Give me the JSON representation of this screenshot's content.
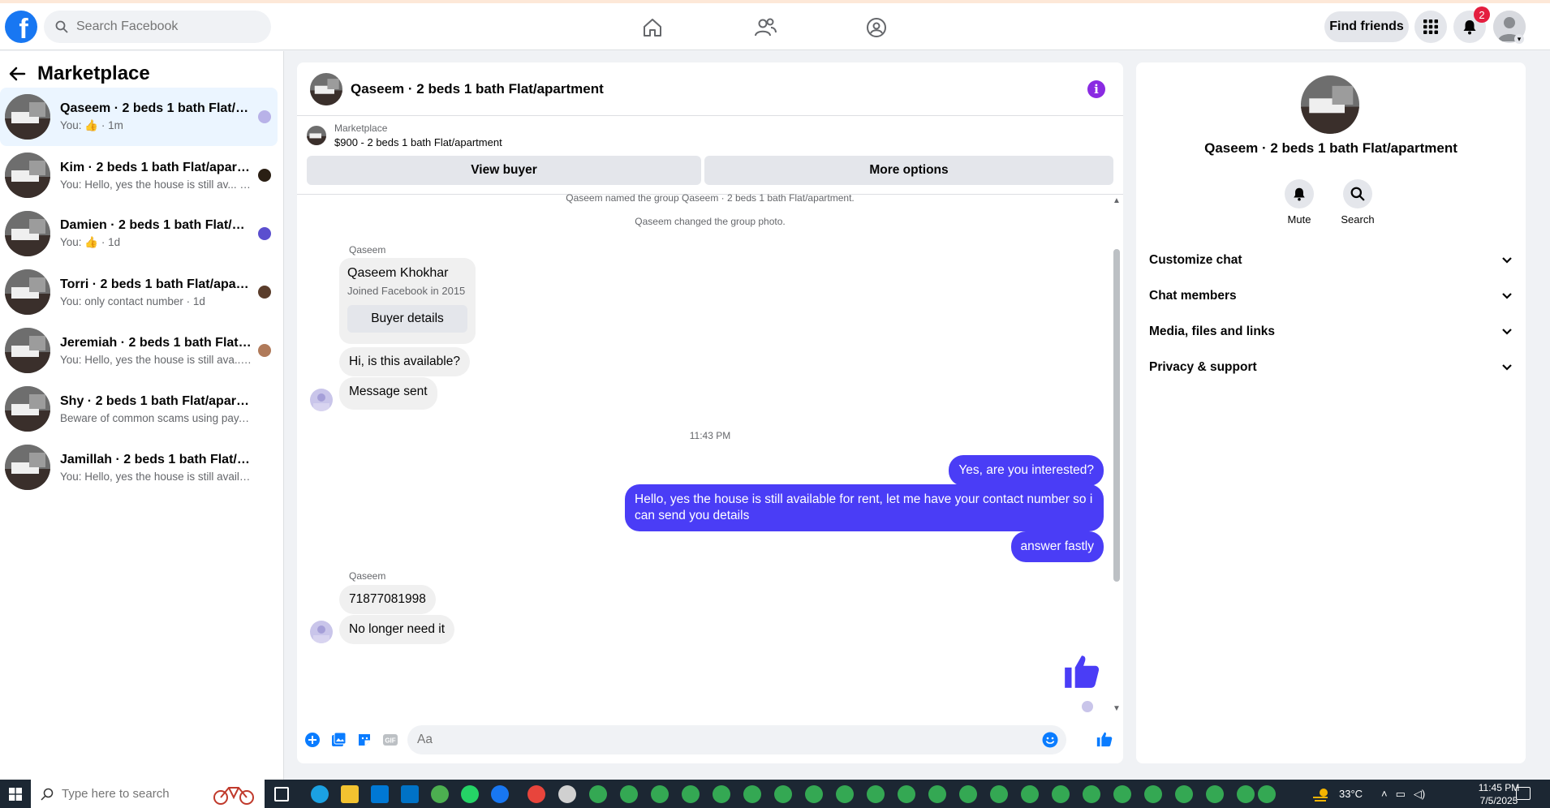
{
  "topbar": {
    "logo_letter": "f",
    "search_placeholder": "Search Facebook",
    "find_friends": "Find friends",
    "notification_count": "2"
  },
  "sidebar": {
    "title": "Marketplace",
    "conversations": [
      {
        "name": "Qaseem · 2 beds 1 bath Flat/apa...",
        "preview": "You: 👍 · 1m",
        "active": true
      },
      {
        "name": "Kim · 2 beds 1 bath Flat/apartm...",
        "preview": "You: Hello, yes the house is still av... · 1m"
      },
      {
        "name": "Damien · 2 beds 1 bath Flat/apa...",
        "preview": "You: 👍 · 1d"
      },
      {
        "name": "Torri · 2 beds 1 bath Flat/apartm...",
        "preview": "You: only contact number · 1d"
      },
      {
        "name": "Jeremiah · 2 beds 1 bath Flat/ap...",
        "preview": "You: Hello, yes the house is still ava... · 1d"
      },
      {
        "name": "Shy · 2 beds 1 bath Flat/apartment",
        "preview": "Beware of common scams using pay... · 2d"
      },
      {
        "name": "Jamillah · 2 beds 1 bath Flat/apart...",
        "preview": "You: Hello, yes the house is still availa... · 2d"
      }
    ]
  },
  "chat": {
    "title": "Qaseem · 2 beds 1 bath Flat/apartment",
    "marketplace_label": "Marketplace",
    "listing": "$900 - 2 beds 1 bath Flat/apartment",
    "view_buyer": "View buyer",
    "more_options": "More options",
    "system_1": "Qaseem named the group Qaseem · 2 beds 1 bath Flat/apartment.",
    "system_2": "Qaseem changed the group photo.",
    "sender_1": "Qaseem",
    "card_name": "Qaseem Khokhar",
    "card_sub": "Joined Facebook in 2015",
    "card_button": "Buyer details",
    "msg_in_1": "Hi, is this available?",
    "msg_in_2": "Message sent",
    "timestamp": "11:43 PM",
    "msg_out_1": "Yes, are you interested?",
    "msg_out_2": "Hello, yes the house is still available for rent, let me have your contact number so i can send you details",
    "msg_out_3": "answer fastly",
    "sender_2": "Qaseem",
    "msg_in_3": "71877081998",
    "msg_in_4": "No longer need it",
    "composer_placeholder": "Aa"
  },
  "right_panel": {
    "name": "Qaseem · 2 beds 1 bath Flat/apartment",
    "mute": "Mute",
    "search": "Search",
    "sections": [
      "Customize chat",
      "Chat members",
      "Media, files and links",
      "Privacy & support"
    ]
  },
  "taskbar": {
    "search_placeholder": "Type here to search",
    "temperature": "33°C",
    "time": "11:45 PM",
    "date": "7/5/2025"
  },
  "colors": {
    "brand": "#1877f2",
    "outgoing_bubble": "#4a3df6",
    "info_icon": "#8a2be2",
    "badge": "#e41e3f"
  }
}
